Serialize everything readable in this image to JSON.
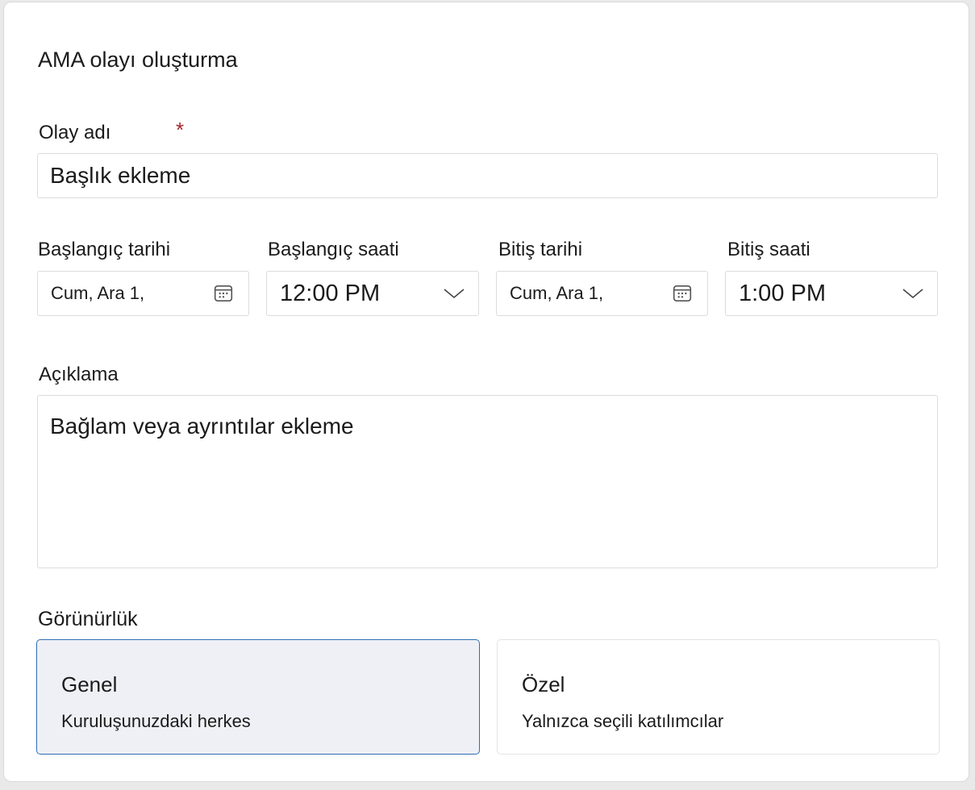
{
  "dialog": {
    "title": "AMA olayı oluşturma"
  },
  "event_name": {
    "label": "Olay adı",
    "required_mark": "*",
    "placeholder": "Başlık ekleme"
  },
  "start_date": {
    "label": "Başlangıç tarihi",
    "value": "Cum, Ara 1,",
    "icon": "calendar-icon"
  },
  "start_time": {
    "label": "Başlangıç saati",
    "value": "12:00 PM",
    "icon": "chevron-down-icon"
  },
  "end_date": {
    "label": "Bitiş tarihi",
    "value": "Cum, Ara 1,",
    "icon": "calendar-icon"
  },
  "end_time": {
    "label": "Bitiş saati",
    "value": "1:00 PM",
    "icon": "chevron-down-icon"
  },
  "description": {
    "label": "Açıklama",
    "placeholder": "Bağlam veya ayrıntılar ekleme"
  },
  "visibility": {
    "label": "Görünürlük",
    "options": [
      {
        "title": "Genel",
        "subtitle": "Kuruluşunuzdaki herkes",
        "selected": true
      },
      {
        "title": "Özel",
        "subtitle": "Yalnızca seçili katılımcılar",
        "selected": false
      }
    ]
  },
  "colors": {
    "required": "#a4262c",
    "selected_border": "#2b6fb6",
    "selected_background": "#eff0f5",
    "input_border": "#dcdcdc"
  }
}
